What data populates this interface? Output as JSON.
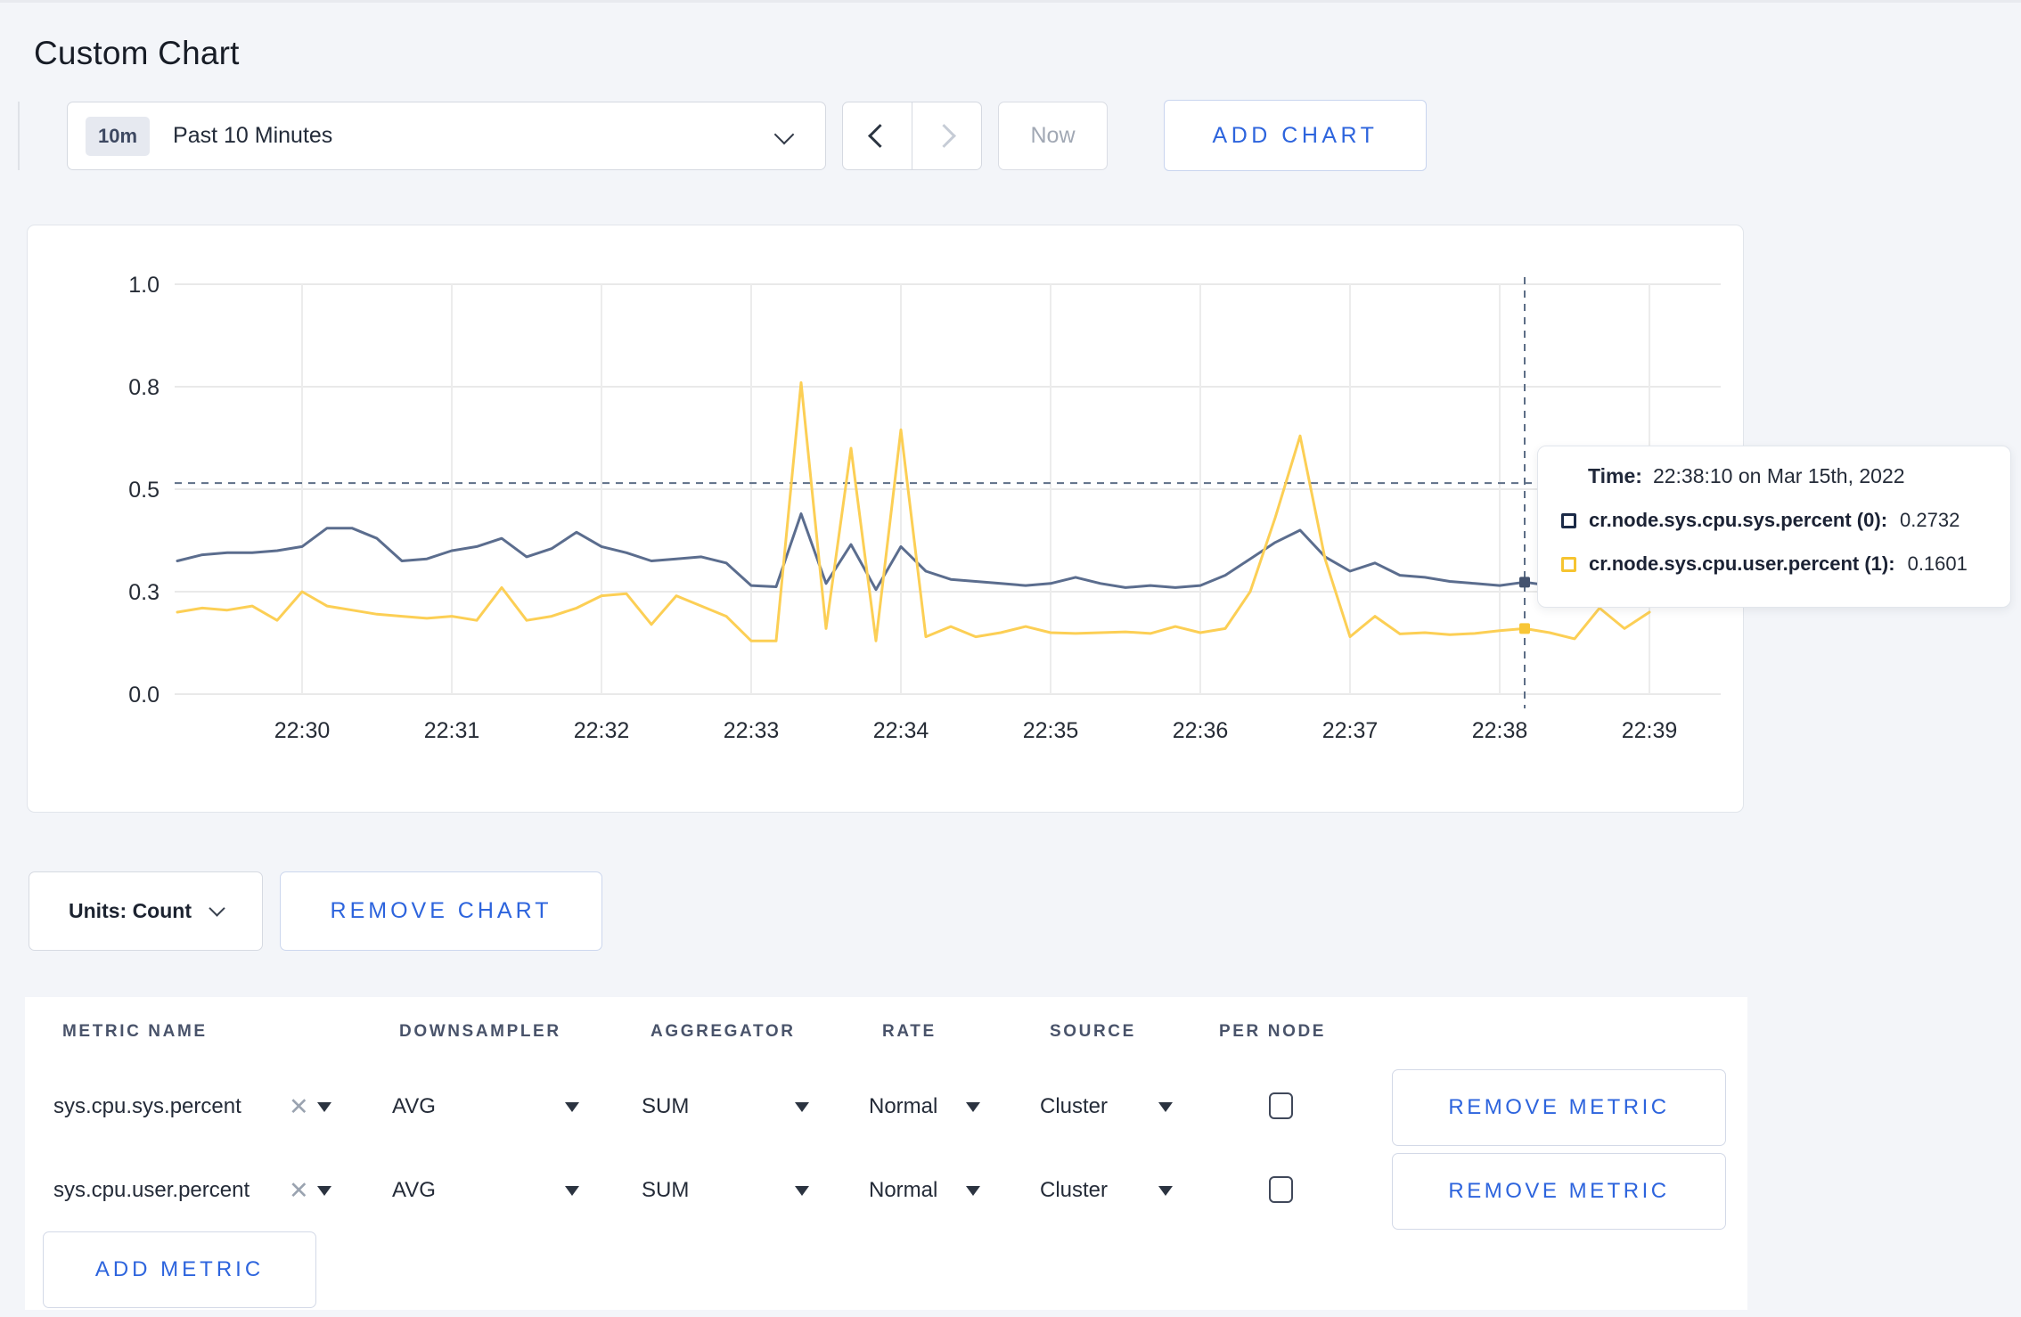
{
  "page": {
    "title": "Custom Chart",
    "background_color": "#f3f5f9",
    "accent_color": "#2d64dd"
  },
  "toolbar": {
    "time_window_badge": "10m",
    "time_window_label": "Past 10 Minutes",
    "now_label": "Now",
    "add_chart_label": "ADD CHART"
  },
  "chart_data": {
    "type": "line",
    "title": "",
    "units": "Count",
    "grid": true,
    "ylim": [
      0,
      1
    ],
    "y_tick_values": [
      0,
      0.25,
      0.5,
      0.75,
      1.0
    ],
    "y_tick_labels": [
      "0.0",
      "0.3",
      "0.5",
      "0.8",
      "1.0"
    ],
    "x_tick_labels": [
      "22:30",
      "22:31",
      "22:32",
      "22:33",
      "22:34",
      "22:35",
      "22:36",
      "22:37",
      "22:38",
      "22:39"
    ],
    "x_start": "22:29:10",
    "x_step_seconds": 10,
    "series": [
      {
        "name": "cr.node.sys.cpu.sys.percent",
        "color": "#5b6d8e",
        "values": [
          0.325,
          0.34,
          0.345,
          0.345,
          0.35,
          0.36,
          0.405,
          0.405,
          0.38,
          0.325,
          0.33,
          0.35,
          0.36,
          0.38,
          0.335,
          0.355,
          0.395,
          0.36,
          0.345,
          0.325,
          0.33,
          0.335,
          0.32,
          0.265,
          0.262,
          0.44,
          0.27,
          0.365,
          0.255,
          0.36,
          0.3,
          0.28,
          0.275,
          0.27,
          0.265,
          0.27,
          0.285,
          0.27,
          0.26,
          0.265,
          0.26,
          0.265,
          0.29,
          0.33,
          0.37,
          0.4,
          0.335,
          0.3,
          0.32,
          0.29,
          0.285,
          0.275,
          0.27,
          0.265,
          0.2732,
          0.265,
          0.27,
          0.28,
          0.275,
          0.28
        ]
      },
      {
        "name": "cr.node.sys.cpu.user.percent",
        "color": "#fccf55",
        "values": [
          0.2,
          0.21,
          0.205,
          0.215,
          0.18,
          0.25,
          0.215,
          0.205,
          0.195,
          0.19,
          0.185,
          0.19,
          0.18,
          0.26,
          0.18,
          0.19,
          0.21,
          0.24,
          0.245,
          0.17,
          0.24,
          0.215,
          0.19,
          0.13,
          0.13,
          0.76,
          0.16,
          0.6,
          0.13,
          0.645,
          0.14,
          0.165,
          0.14,
          0.15,
          0.165,
          0.15,
          0.148,
          0.15,
          0.152,
          0.148,
          0.165,
          0.15,
          0.16,
          0.25,
          0.43,
          0.63,
          0.33,
          0.14,
          0.19,
          0.147,
          0.15,
          0.145,
          0.148,
          0.155,
          0.1601,
          0.15,
          0.135,
          0.21,
          0.16,
          0.2
        ]
      }
    ],
    "crosshair": {
      "time": "22:38:10",
      "hover_index": 54,
      "guide_value": 0.515
    },
    "tooltip": {
      "time_label": "Time:",
      "time_value": "22:38:10 on Mar 15th, 2022",
      "rows": [
        {
          "name": "cr.node.sys.cpu.sys.percent (0):",
          "value": "0.2732",
          "swatch_color": "#1b2a47"
        },
        {
          "name": "cr.node.sys.cpu.user.percent (1):",
          "value": "0.1601",
          "swatch_color": "#f6c430"
        }
      ]
    }
  },
  "chart_footer": {
    "units_label": "Units: Count",
    "remove_chart_label": "REMOVE CHART"
  },
  "metrics_table": {
    "headers": [
      "METRIC NAME",
      "DOWNSAMPLER",
      "AGGREGATOR",
      "RATE",
      "SOURCE",
      "PER NODE"
    ],
    "rows": [
      {
        "metric": "sys.cpu.sys.percent",
        "downsampler": "AVG",
        "aggregator": "SUM",
        "rate": "Normal",
        "source": "Cluster",
        "per_node_checked": false,
        "remove_label": "REMOVE METRIC"
      },
      {
        "metric": "sys.cpu.user.percent",
        "downsampler": "AVG",
        "aggregator": "SUM",
        "rate": "Normal",
        "source": "Cluster",
        "per_node_checked": false,
        "remove_label": "REMOVE METRIC"
      }
    ],
    "add_metric_label": "ADD METRIC"
  }
}
